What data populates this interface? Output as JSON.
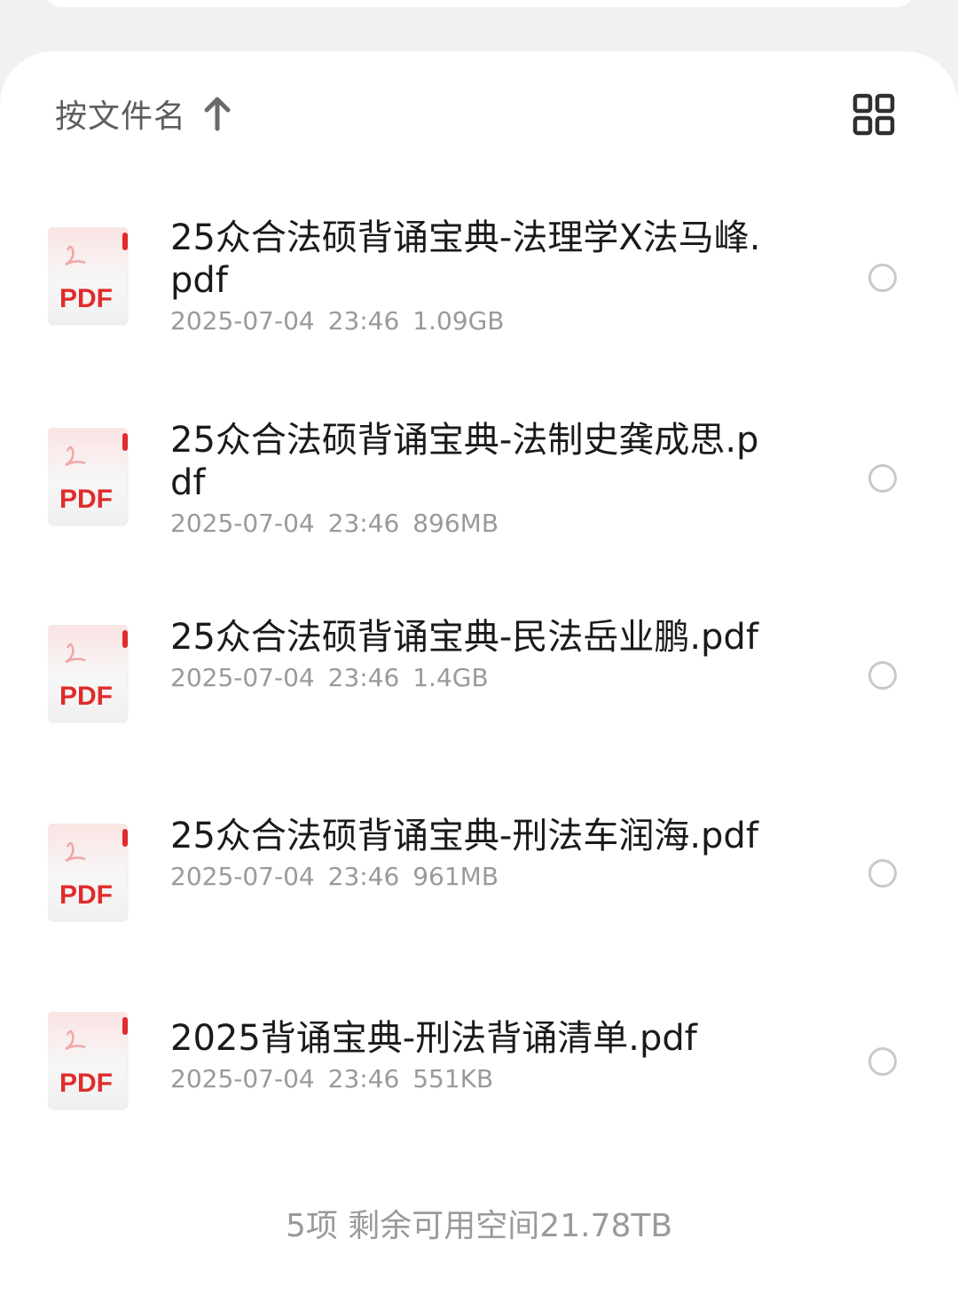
{
  "sort": {
    "label": "按文件名",
    "direction_icon": "arrow-up-icon"
  },
  "view_toggle_icon": "grid-view-icon",
  "icon_label": "PDF",
  "colors": {
    "pdf_red": "#e02b2b",
    "radio_border": "#c9c9c9"
  },
  "files": [
    {
      "name": "25众合法硕背诵宝典-法理学X法马峰.pdf",
      "date": "2025-07-04 23:46",
      "size": "1.09GB"
    },
    {
      "name": "25众合法硕背诵宝典-法制史龚成思.pdf",
      "date": "2025-07-04 23:46",
      "size": "896MB"
    },
    {
      "name": "25众合法硕背诵宝典-民法岳业鹏.pdf",
      "date": "2025-07-04 23:46",
      "size": "1.4GB"
    },
    {
      "name": "25众合法硕背诵宝典-刑法车润海.pdf",
      "date": "2025-07-04 23:46",
      "size": "961MB"
    },
    {
      "name": "2025背诵宝典-刑法背诵清单.pdf",
      "date": "2025-07-04 23:46",
      "size": "551KB"
    }
  ],
  "footer": "5项 剩余可用空间21.78TB"
}
